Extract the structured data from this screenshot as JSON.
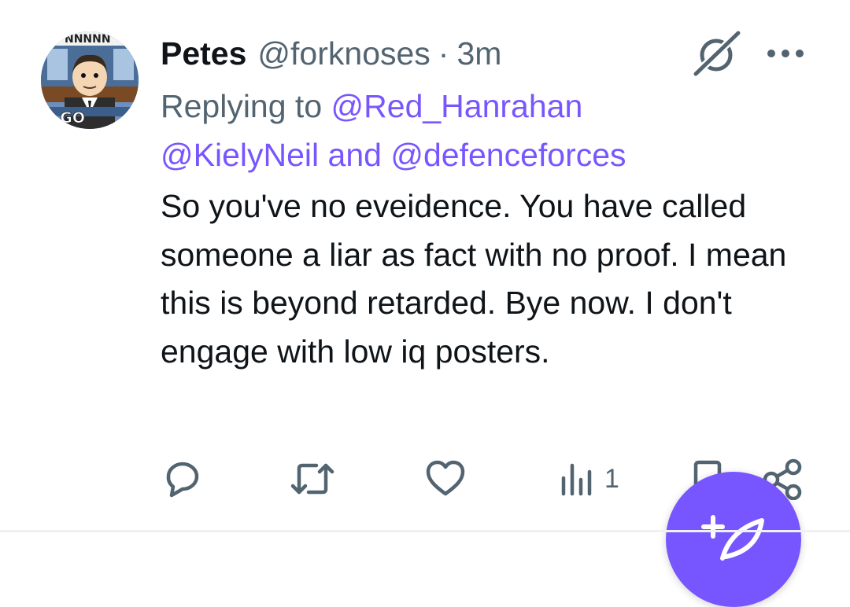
{
  "tweet": {
    "display_name": "Petes",
    "handle": "@forknoses",
    "separator": "·",
    "time": "3m",
    "replying_prefix": "Replying to",
    "mention_1": "@Red_Hanrahan",
    "mention_2": "@KielyNeil",
    "mention_joiner": "and",
    "mention_3": "@defenceforces",
    "body": "So you've no eveidence. You have called someone a liar as fact with no proof. I mean this is beyond retarded. Bye now. I don't engage with low iq posters."
  },
  "avatar": {
    "banner_text": "NNNNN",
    "bottom_text": "S GO"
  },
  "actions": {
    "views_count": "1"
  },
  "icons": {
    "header": [
      "grok-icon",
      "more-icon"
    ],
    "actions": [
      "reply-icon",
      "retweet-icon",
      "like-icon",
      "views-icon",
      "bookmark-icon",
      "share-icon"
    ],
    "fab": "compose-icon"
  },
  "colors": {
    "accent": "#7856ff",
    "secondary_text": "#536471",
    "primary_text": "#0f1419",
    "background": "#ffffff"
  }
}
